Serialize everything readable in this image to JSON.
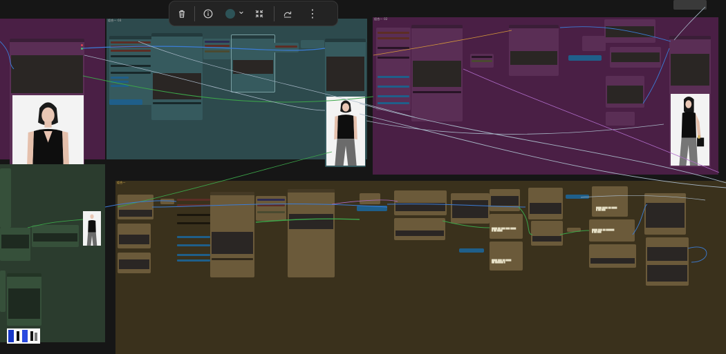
{
  "toolbar": {
    "delete_icon": "trash-icon",
    "info_icon": "info-icon",
    "color_swatch": "#2d5357",
    "color_dropdown_icon": "chevron-down-icon",
    "collapse_icon": "collapse-icon",
    "bypass_icon": "redo-arrow-icon",
    "more_icon": "more-vertical-icon",
    "glyph_chevron": "⌄",
    "glyph_more": "⋮"
  },
  "groups": {
    "teal": {
      "title": "组合一 03",
      "color": "#2d4a4d"
    },
    "purple": {
      "title": "组合一 02",
      "color": "#4a1f45"
    },
    "brown": {
      "title": "组合一",
      "color": "#3a311c"
    },
    "green": {
      "title": "",
      "color": "#2b3c2e"
    }
  },
  "notes": {
    "brown_a": "████ ██ ███ ███ ████\n█ ██ ████",
    "brown_b": "████ ███ ██ ████\n██ ██████ █",
    "brown_c": "████ ████ ██ ████\n█ ██ ███",
    "brown_d": "████ ███ ██ ██████\n█ ██ ███"
  },
  "colors": {
    "wire_blue": "#3b7dd8",
    "wire_green": "#3ca64a",
    "wire_gray": "#a8b8c8",
    "wire_purple": "#b06cc9",
    "wire_orange": "#d89a3a"
  }
}
